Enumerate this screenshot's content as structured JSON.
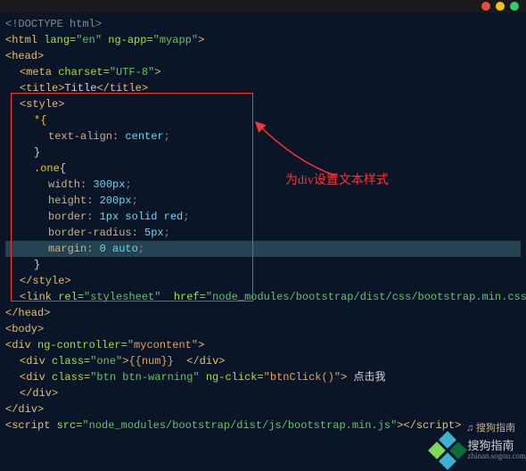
{
  "lines": {
    "l1": "<!DOCTYPE html>",
    "l2a": "<html ",
    "l2b": "lang=",
    "l2c": "\"en\"",
    "l2d": " ng-app=",
    "l2e": "\"myapp\"",
    "l2f": ">",
    "l3": "<head>",
    "l4a": "<meta ",
    "l4b": "charset=",
    "l4c": "\"UTF-8\"",
    "l4d": ">",
    "l5a": "<title>",
    "l5b": "Title",
    "l5c": "</title>",
    "l6": "<style>",
    "l7": "*{",
    "l8a": "text-align: ",
    "l8b": "center",
    "l8c": ";",
    "l9": "}",
    "l10a": ".",
    "l10b": "one",
    "l10c": "{",
    "l11a": "width: ",
    "l11b": "300px",
    "l11c": ";",
    "l12a": "height: ",
    "l12b": "200px",
    "l12c": ";",
    "l13a": "border: ",
    "l13b": "1px solid red",
    "l13c": ";",
    "l14a": "border-radius: ",
    "l14b": "5px",
    "l14c": ";",
    "l15a": "margin: ",
    "l15b": "0 auto",
    "l15c": ";",
    "l16": "}",
    "l17": "</style>",
    "l18a": "<link ",
    "l18b": "rel=",
    "l18c": "\"stylesheet\"",
    "l18d": "  href=",
    "l18e": "\"node_modules/bootstrap/dist/css/bootstrap.min.css\"",
    "l19": "</head>",
    "l20": "<body>",
    "l21a": "<div ",
    "l21b": "ng-controller=",
    "l21c": "\"mycontent\"",
    "l21d": ">",
    "l22a": "<div ",
    "l22b": "class=",
    "l22c": "\"one\"",
    "l22d": ">",
    "l22e": "{{num}}",
    "l22f": "  </div>",
    "l23a": "<div ",
    "l23b": "class=",
    "l23c": "\"btn btn-warning\"",
    "l23d": " ng-click=",
    "l23e": "\"btnClick()\"",
    "l23f": "> ",
    "l23g": "点击我",
    "l24": "</div>",
    "l25": "</div>",
    "l26a": "<script ",
    "l26b": "src=",
    "l26c": "\"node_modules/bootstrap/dist/js/bootstrap.min.js\"",
    "l26d": "><",
    "l26e": "/script>"
  },
  "annotation": "为div设置文本样式",
  "wm_title": "搜狗指南",
  "wm_sub": "zhinan.sogou.com"
}
